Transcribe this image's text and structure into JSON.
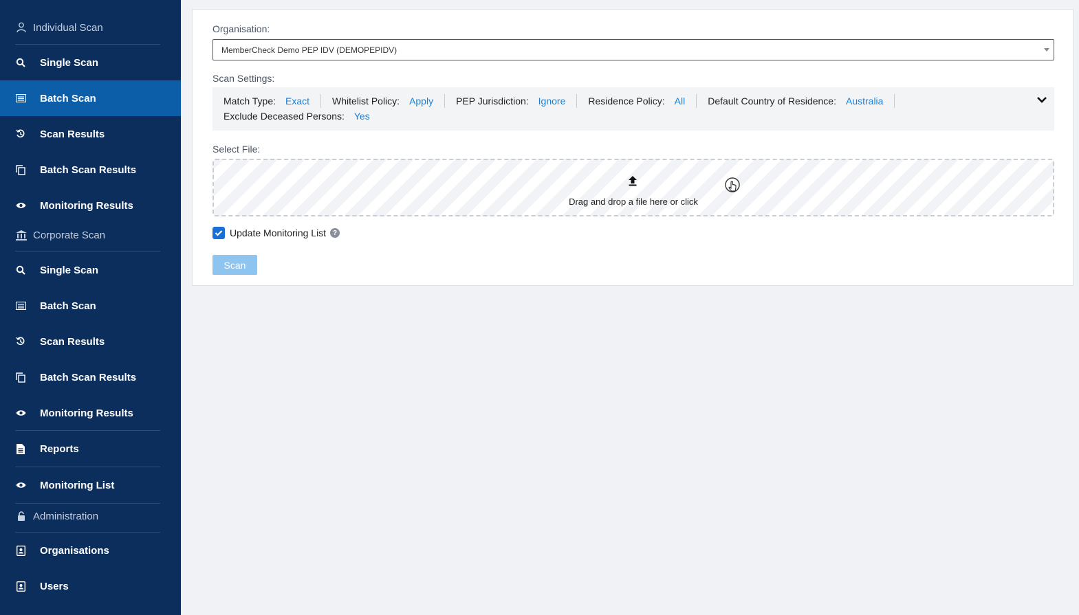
{
  "sidebar": {
    "individual_header": "Individual Scan",
    "individual_items": [
      {
        "label": "Single Scan"
      },
      {
        "label": "Batch Scan"
      },
      {
        "label": "Scan Results"
      },
      {
        "label": "Batch Scan Results"
      },
      {
        "label": "Monitoring Results"
      }
    ],
    "corporate_header": "Corporate Scan",
    "corporate_items": [
      {
        "label": "Single Scan"
      },
      {
        "label": "Batch Scan"
      },
      {
        "label": "Scan Results"
      },
      {
        "label": "Batch Scan Results"
      },
      {
        "label": "Monitoring Results"
      }
    ],
    "reports": "Reports",
    "monitoring_list": "Monitoring List",
    "admin_header": "Administration",
    "admin_items": [
      {
        "label": "Organisations"
      },
      {
        "label": "Users"
      }
    ],
    "active_item": "Batch Scan"
  },
  "form": {
    "organisation_label": "Organisation:",
    "organisation_value": "MemberCheck Demo PEP IDV (DEMOPEPIDV)",
    "scan_settings_label": "Scan Settings:",
    "settings": {
      "match_type_label": "Match Type:",
      "match_type_value": "Exact",
      "whitelist_label": "Whitelist Policy:",
      "whitelist_value": "Apply",
      "pep_label": "PEP Jurisdiction:",
      "pep_value": "Ignore",
      "residence_label": "Residence Policy:",
      "residence_value": "All",
      "country_label": "Default Country of Residence:",
      "country_value": "Australia",
      "deceased_label": "Exclude Deceased Persons:",
      "deceased_value": "Yes"
    },
    "select_file_label": "Select File:",
    "dropzone_text": "Drag and drop a file here or click",
    "update_monitoring_label": "Update Monitoring List",
    "update_monitoring_checked": true,
    "help_glyph": "?",
    "scan_button": "Scan"
  },
  "colors": {
    "sidebar_bg": "#0c2e5c",
    "active_bg": "#0d5ea8",
    "link_blue": "#1a7fd8",
    "button_disabled": "#8ec4f0"
  }
}
